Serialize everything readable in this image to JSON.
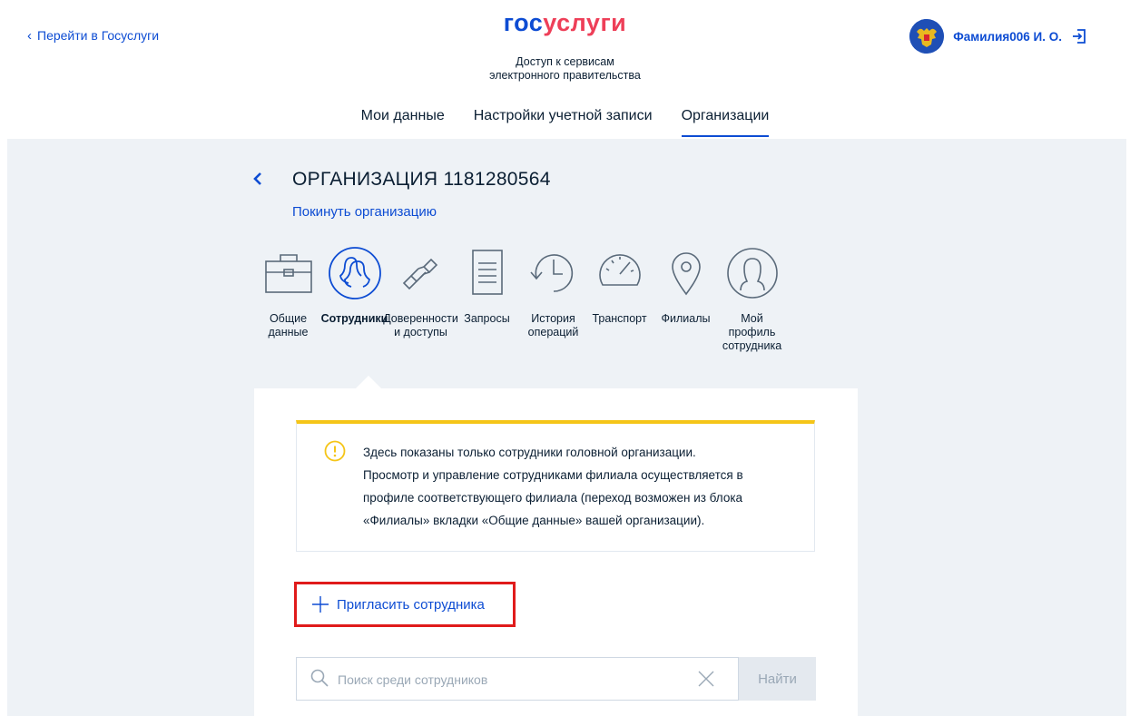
{
  "header": {
    "back_link": "Перейти в Госуслуги",
    "logo_part1": "гос",
    "logo_part2": "услуги",
    "subtitle_line1": "Доступ к сервисам",
    "subtitle_line2": "электронного правительства",
    "user_name": "Фамилия006 И. О."
  },
  "topnav": {
    "tabs": [
      {
        "label": "Мои данные"
      },
      {
        "label": "Настройки учетной записи"
      },
      {
        "label": "Организации",
        "active": true
      }
    ]
  },
  "org": {
    "title": "ОРГАНИЗАЦИЯ 1181280564",
    "leave_link": "Покинуть организацию"
  },
  "sections": [
    {
      "label_line1": "Общие",
      "label_line2": "данные",
      "icon": "briefcase-icon"
    },
    {
      "label_line1": "Сотрудники",
      "label_line2": "",
      "icon": "employees-icon",
      "active": true
    },
    {
      "label_line1": "Доверенности",
      "label_line2": "и доступы",
      "icon": "chain-link-icon"
    },
    {
      "label_line1": "Запросы",
      "label_line2": "",
      "icon": "document-icon"
    },
    {
      "label_line1": "История",
      "label_line2": "операций",
      "icon": "history-icon"
    },
    {
      "label_line1": "Транспорт",
      "label_line2": "",
      "icon": "speedometer-icon"
    },
    {
      "label_line1": "Филиалы",
      "label_line2": "",
      "icon": "location-pin-icon"
    },
    {
      "label_line1": "Мой",
      "label_line2": "профиль",
      "label_line3": "сотрудника",
      "icon": "profile-icon"
    }
  ],
  "notice": {
    "line1": "Здесь показаны только сотрудники головной организации.",
    "line2": "Просмотр и управление сотрудниками филиала осуществляется в",
    "line3": "профиле соответствующего филиала (переход возможен из блока",
    "line4": "«Филиалы» вкладки «Общие данные» вашей организации)."
  },
  "invite_label": "Пригласить сотрудника",
  "search": {
    "placeholder": "Поиск среди сотрудников",
    "value": "",
    "button": "Найти"
  },
  "colors": {
    "brand_blue": "#0d4cd3",
    "brand_red": "#ee3f58",
    "warning_yellow": "#f5c518",
    "highlight_red": "#e01b1b",
    "background_grey": "#eef2f6"
  }
}
